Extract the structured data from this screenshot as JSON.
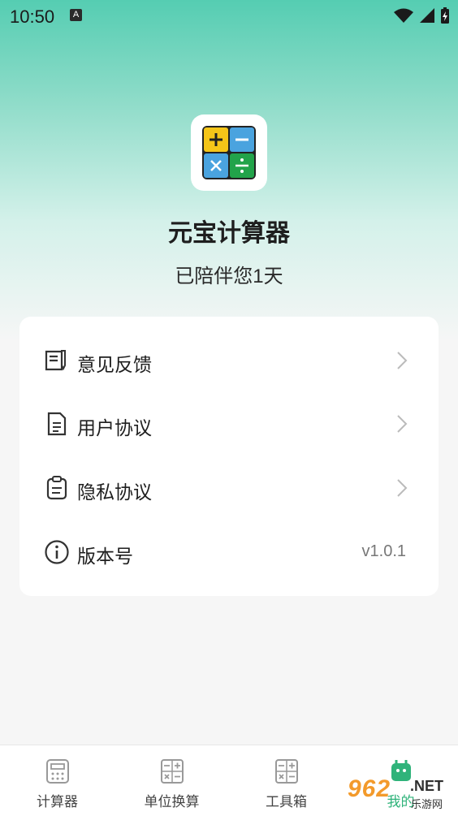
{
  "status_bar": {
    "time": "10:50",
    "notif_badge": "A"
  },
  "app": {
    "name": "元宝计算器",
    "subtitle": "已陪伴您1天",
    "icon_tiles": [
      "+",
      "−",
      "×",
      "÷"
    ],
    "tile_colors": [
      "#f5c518",
      "#4aa3df",
      "#4aa3df",
      "#22a34a"
    ]
  },
  "menu": {
    "items": [
      {
        "label": "意见反馈",
        "icon": "feedback-icon"
      },
      {
        "label": "用户协议",
        "icon": "document-icon"
      },
      {
        "label": "隐私协议",
        "icon": "clipboard-icon"
      },
      {
        "label": "版本号",
        "icon": "info-icon",
        "value": "v1.0.1"
      }
    ]
  },
  "tabs": [
    {
      "label": "计算器",
      "icon": "calculator-icon"
    },
    {
      "label": "单位换算",
      "icon": "conversion-icon"
    },
    {
      "label": "工具箱",
      "icon": "toolbox-icon"
    },
    {
      "label": "我的",
      "icon": "profile-icon",
      "active": true
    }
  ],
  "watermark": {
    "brand": "962",
    "suffix": ".NET",
    "sub": "乐游网"
  },
  "colors": {
    "accent": "#2fb37a",
    "header_gradient_top": "#55cdb2"
  }
}
